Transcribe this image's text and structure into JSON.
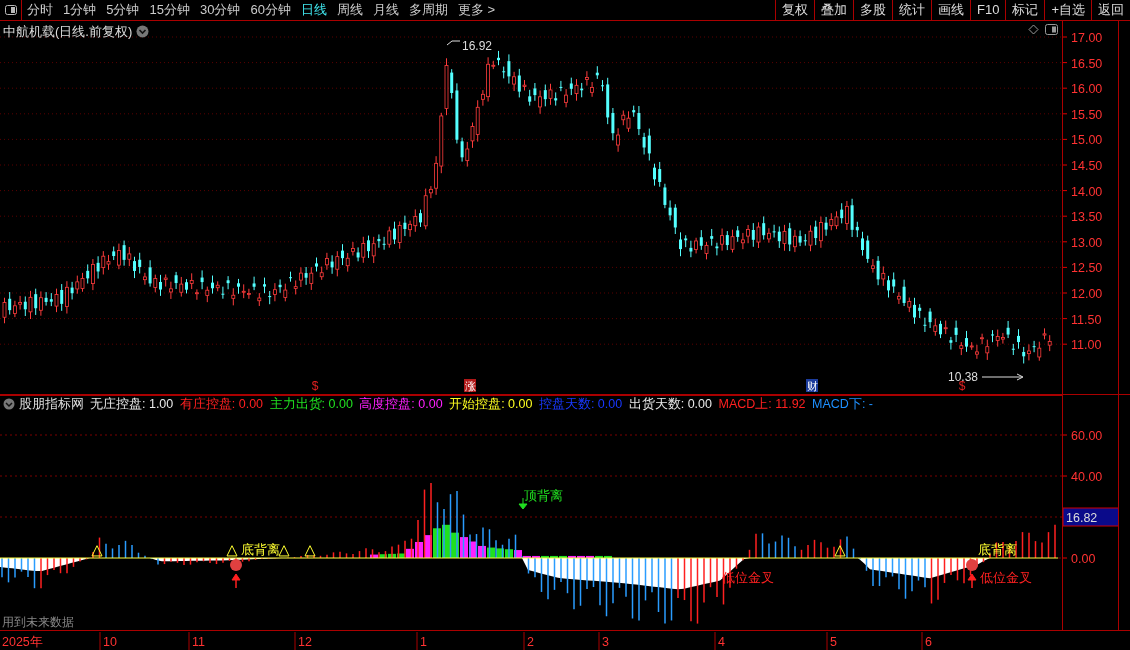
{
  "toolbar": {
    "periods": [
      {
        "label": "分时",
        "selected": false
      },
      {
        "label": "1分钟",
        "selected": false
      },
      {
        "label": "5分钟",
        "selected": false
      },
      {
        "label": "15分钟",
        "selected": false
      },
      {
        "label": "30分钟",
        "selected": false
      },
      {
        "label": "60分钟",
        "selected": false
      },
      {
        "label": "日线",
        "selected": true
      },
      {
        "label": "周线",
        "selected": false
      },
      {
        "label": "月线",
        "selected": false
      },
      {
        "label": "多周期",
        "selected": false
      },
      {
        "label": "更多 >",
        "selected": false
      }
    ],
    "actions": [
      "复权",
      "叠加",
      "多股",
      "统计",
      "画线",
      "F10",
      "标记",
      "+自选",
      "返回"
    ]
  },
  "price_chart": {
    "title": "中航机载(日线.前复权)",
    "y_axis": [
      "17.00",
      "16.50",
      "16.00",
      "15.50",
      "15.00",
      "14.50",
      "14.00",
      "13.50",
      "13.00",
      "12.50",
      "12.00",
      "11.50",
      "11.00"
    ],
    "high_label": "16.92",
    "low_label": "10.38",
    "events": [
      {
        "text": "$",
        "kind": "text",
        "color": "#e02020"
      },
      {
        "text": "涨",
        "kind": "tag",
        "color": "#b01818"
      },
      {
        "text": "财",
        "kind": "tag",
        "color": "#1c3c9c"
      },
      {
        "text": "$",
        "kind": "text",
        "color": "#e02020"
      }
    ]
  },
  "indicator": {
    "name": "股朋指标网",
    "values": [
      {
        "text": "无庄控盘: 1.00",
        "color": "#e8e8e8"
      },
      {
        "text": "有庄控盘: 0.00",
        "color": "#ff2020"
      },
      {
        "text": "主力出货: 0.00",
        "color": "#20e020"
      },
      {
        "text": "高度控盘: 0.00",
        "color": "#ff20ff"
      },
      {
        "text": "开始控盘: 0.00",
        "color": "#ffff20"
      },
      {
        "text": "控盘天数: 0.00",
        "color": "#1838ff"
      },
      {
        "text": "出货天数: 0.00",
        "color": "#e8e8e8"
      },
      {
        "text": "MACD上: 11.92",
        "color": "#ff2020"
      },
      {
        "text": "MACD下: -",
        "color": "#1e90ff"
      }
    ],
    "y_axis": [
      "60.00",
      "40.00",
      "0.00"
    ],
    "current": "16.82",
    "signals": [
      {
        "text": "顶背离",
        "kind": "top"
      },
      {
        "text": "底背离",
        "kind": "bottom"
      },
      {
        "text": "低位金叉",
        "kind": "cross"
      },
      {
        "text": "底背离",
        "kind": "bottom"
      },
      {
        "text": "低位金叉",
        "kind": "cross"
      }
    ],
    "note": "用到未来数据"
  },
  "time_axis": [
    "2025年",
    "10",
    "11",
    "12",
    "1",
    "2",
    "3",
    "4",
    "5",
    "6"
  ]
}
